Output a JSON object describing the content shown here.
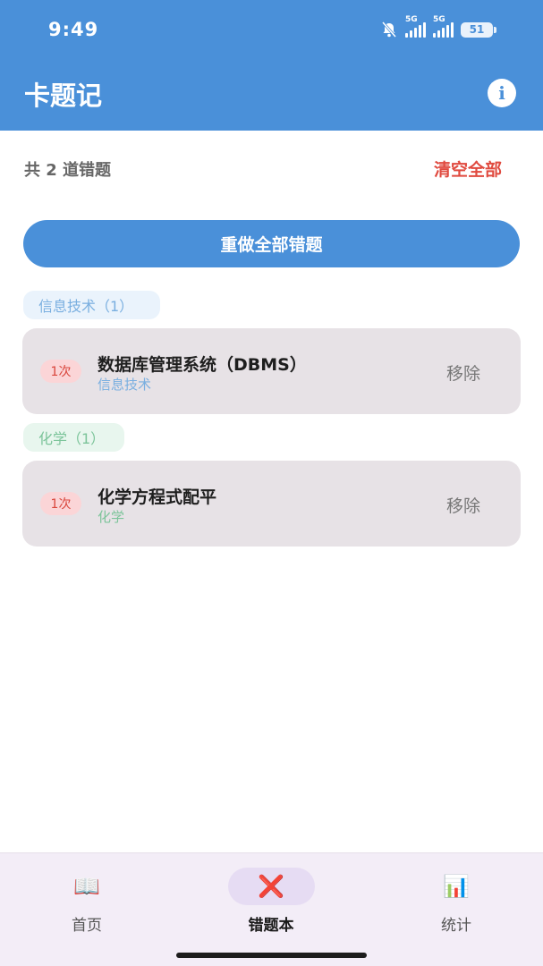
{
  "status_bar": {
    "time": "9:49",
    "network_1": "5G",
    "network_2": "5G",
    "battery": "51"
  },
  "app_bar": {
    "title": "卡题记",
    "info_icon": "info-icon"
  },
  "summary": {
    "count_text": "共 2 道错题",
    "clear_all_label": "清空全部"
  },
  "redo_all_label": "重做全部错题",
  "groups": [
    {
      "label": "信息技术（1）",
      "items": [
        {
          "count": "1次",
          "title": "数据库管理系统（DBMS）",
          "category": "信息技术",
          "remove_label": "移除"
        }
      ]
    },
    {
      "label": "化学（1）",
      "items": [
        {
          "count": "1次",
          "title": "化学方程式配平",
          "category": "化学",
          "remove_label": "移除"
        }
      ]
    }
  ],
  "bottom_nav": [
    {
      "label": "首页",
      "icon": "📖",
      "active": false
    },
    {
      "label": "错题本",
      "icon": "❌",
      "active": true
    },
    {
      "label": "统计",
      "icon": "📊",
      "active": false
    }
  ],
  "colors": {
    "primary": "#4a90d9",
    "danger": "#e04a3f",
    "card_bg": "#e7e2e6"
  }
}
